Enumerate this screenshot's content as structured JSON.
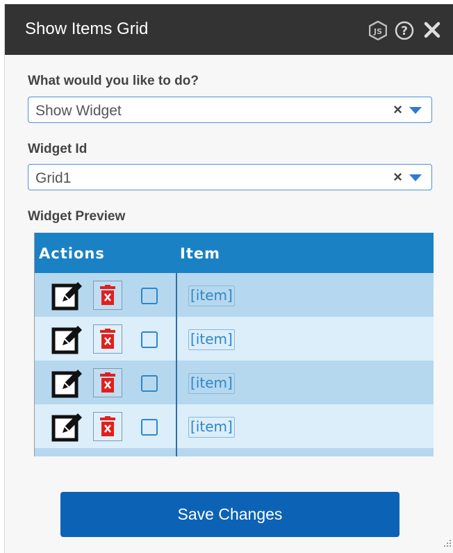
{
  "dialog": {
    "title": "Show Items Grid",
    "icons": [
      "js-icon",
      "help-icon",
      "close-icon"
    ]
  },
  "form": {
    "action_label": "What would you like to do?",
    "action_value": "Show Widget",
    "widget_id_label": "Widget Id",
    "widget_id_value": "Grid1",
    "clear_glyph": "×",
    "preview_label": "Widget Preview"
  },
  "grid": {
    "columns": [
      "Actions",
      "Item"
    ],
    "rows": [
      {
        "item": "[item]"
      },
      {
        "item": "[item]"
      },
      {
        "item": "[item]"
      },
      {
        "item": "[item]"
      }
    ]
  },
  "footer": {
    "save_label": "Save Changes"
  },
  "colors": {
    "titlebar": "#333333",
    "header_blue": "#1a82c4",
    "row_dark": "#b5d8ef",
    "row_light": "#dbeefa",
    "save_button": "#0c63b5",
    "delete_red": "#e0201f"
  }
}
